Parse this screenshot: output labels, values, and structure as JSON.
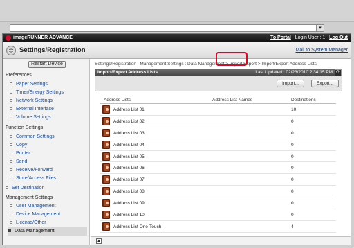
{
  "browser": {
    "dropdown_icon": "chevron-down-icon"
  },
  "brand": {
    "name": "imageRUNNER ADVANCE"
  },
  "toplinks": {
    "to_portal": "To Portal",
    "login_user": "Login User : 1",
    "log_out": "Log Out"
  },
  "header": {
    "title": "Settings/Registration",
    "mail_link": "Mail to System Manager"
  },
  "sidebar": {
    "restart_label": "Restart Device",
    "preferences_head": "Preferences",
    "preferences": [
      "Paper Settings",
      "Timer/Energy Settings",
      "Network Settings",
      "External Interface",
      "Volume Settings"
    ],
    "function_head": "Function Settings",
    "functions": [
      "Common Settings",
      "Copy",
      "Printer",
      "Send",
      "Receive/Forward",
      "Store/Access Files"
    ],
    "set_destination": "Set Destination",
    "management_head": "Management Settings",
    "management": [
      "User Management",
      "Device Management",
      "License/Other",
      "Data Management"
    ],
    "active_item": "Data Management"
  },
  "content": {
    "breadcrumb": "Settings/Registration : Management Settings : Data Management > Import/Export > Import/Export Address Lists",
    "panel_title": "Import/Export Address Lists",
    "last_updated": "Last Updated : 02/23/2010 2:34:15 PM",
    "import_label": "Import...",
    "export_label": "Export...",
    "table": {
      "headers": [
        "Address Lists",
        "Address List Names",
        "Destinations"
      ],
      "rows": [
        {
          "name": "Address List 01",
          "names": "",
          "dest": "10"
        },
        {
          "name": "Address List 02",
          "names": "",
          "dest": "0"
        },
        {
          "name": "Address List 03",
          "names": "",
          "dest": "0"
        },
        {
          "name": "Address List 04",
          "names": "",
          "dest": "0"
        },
        {
          "name": "Address List 05",
          "names": "",
          "dest": "0"
        },
        {
          "name": "Address List 06",
          "names": "",
          "dest": "0"
        },
        {
          "name": "Address List 07",
          "names": "",
          "dest": "0"
        },
        {
          "name": "Address List 08",
          "names": "",
          "dest": "0"
        },
        {
          "name": "Address List 09",
          "names": "",
          "dest": "0"
        },
        {
          "name": "Address List 10",
          "names": "",
          "dest": "0"
        },
        {
          "name": "Address List One-Touch",
          "names": "",
          "dest": "4"
        }
      ]
    }
  },
  "colors": {
    "highlight": "#c8102e",
    "brand_red": "#c8102e",
    "link": "#1f4a8a"
  }
}
